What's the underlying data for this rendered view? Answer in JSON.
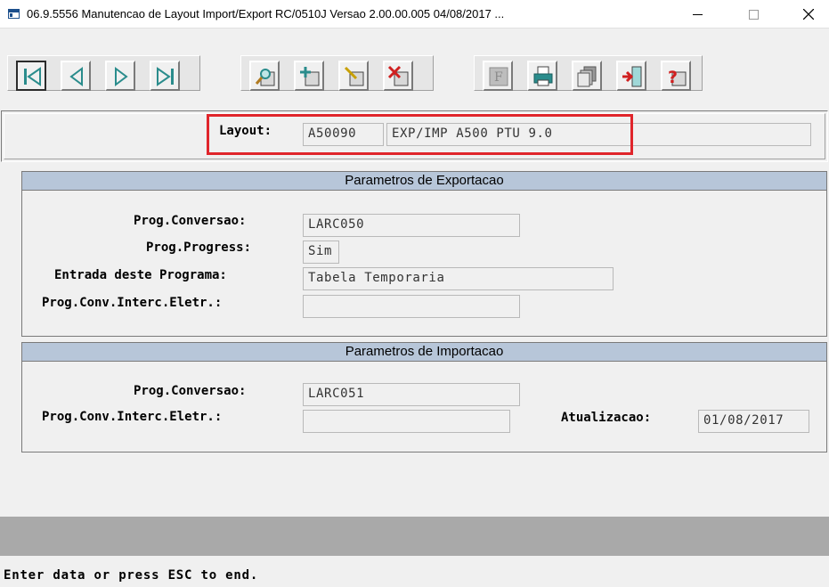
{
  "window": {
    "title": "06.9.5556 Manutencao  de Layout Import/Export RC/0510J Versao 2.00.00.005 04/08/2017 ..."
  },
  "toolbar": {
    "buttons": [
      {
        "name": "first-record",
        "icon": "first-icon"
      },
      {
        "name": "previous-record",
        "icon": "previous-icon"
      },
      {
        "name": "next-record",
        "icon": "next-icon"
      },
      {
        "name": "last-record",
        "icon": "last-icon"
      },
      {
        "name": "search",
        "icon": "search-icon"
      },
      {
        "name": "add",
        "icon": "add-icon"
      },
      {
        "name": "edit",
        "icon": "edit-icon"
      },
      {
        "name": "delete",
        "icon": "delete-icon"
      },
      {
        "name": "filter",
        "icon": "filter-icon"
      },
      {
        "name": "print",
        "icon": "print-icon"
      },
      {
        "name": "copy",
        "icon": "copy-icon"
      },
      {
        "name": "exit",
        "icon": "exit-icon"
      },
      {
        "name": "help",
        "icon": "help-icon"
      }
    ]
  },
  "header": {
    "layout_label": "Layout:",
    "layout_code": "A50090",
    "layout_desc": "EXP/IMP A500 PTU 9.0"
  },
  "export_params": {
    "title": "Parametros de Exportacao",
    "prog_conversao_label": "Prog.Conversao:",
    "prog_conversao_value": "LARC050",
    "prog_progress_label": "Prog.Progress:",
    "prog_progress_value": "Sim",
    "entrada_label": "Entrada deste Programa:",
    "entrada_value": "Tabela Temporaria",
    "prog_conv_interc_label": "Prog.Conv.Interc.Eletr.:",
    "prog_conv_interc_value": ""
  },
  "import_params": {
    "title": "Parametros de Importacao",
    "prog_conversao_label": "Prog.Conversao:",
    "prog_conversao_value": "LARC051",
    "prog_conv_interc_label": "Prog.Conv.Interc.Eletr.:",
    "prog_conv_interc_value": "",
    "atualizacao_label": "Atualizacao:",
    "atualizacao_value": "01/08/2017"
  },
  "status": {
    "message": "Enter data or press ESC to end."
  },
  "colors": {
    "highlight": "#e0252b",
    "frame_header": "#b7c6d9",
    "toolbar_icon_teal": "#2a8c8c"
  }
}
